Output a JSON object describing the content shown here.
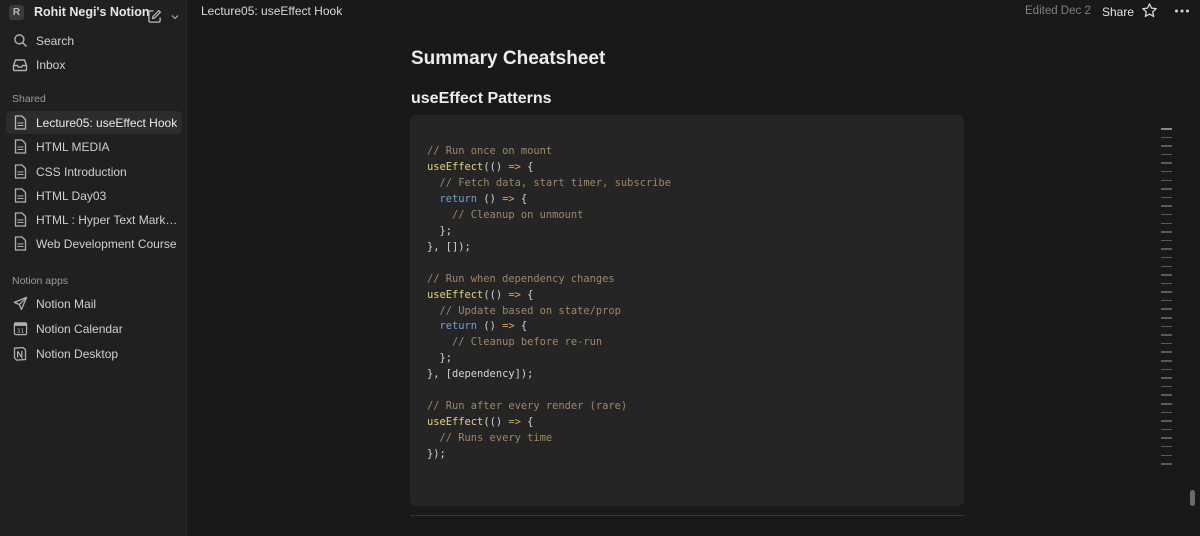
{
  "sidebar": {
    "workspace_initial": "R",
    "workspace_name": "Rohit Negi's Notion",
    "top_items": [
      {
        "label": "Search",
        "icon": "search-icon"
      },
      {
        "label": "Inbox",
        "icon": "inbox-icon"
      }
    ],
    "shared_label": "Shared",
    "shared_items": [
      {
        "label": "Lecture05: useEffect Hook",
        "active": true
      },
      {
        "label": "HTML MEDIA"
      },
      {
        "label": "CSS Introduction"
      },
      {
        "label": "HTML Day03"
      },
      {
        "label": "HTML : Hyper Text Marku..."
      },
      {
        "label": "Web Development Course"
      }
    ],
    "apps_label": "Notion apps",
    "apps_items": [
      {
        "label": "Notion Mail",
        "icon": "mail-send-icon"
      },
      {
        "label": "Notion Calendar",
        "icon": "calendar-icon"
      },
      {
        "label": "Notion Desktop",
        "icon": "notion-logo-icon"
      }
    ]
  },
  "topbar": {
    "breadcrumb": "Lecture05: useEffect Hook",
    "edited": "Edited Dec 2",
    "share_label": "Share"
  },
  "page": {
    "heading1": "Summary Cheatsheet",
    "heading2": "useEffect Patterns",
    "code_lines": [
      "// Run once on mount",
      "useEffect(() => {",
      "  // Fetch data, start timer, subscribe",
      "  return () => {",
      "    // Cleanup on unmount",
      "  };",
      "}, []);",
      "",
      "// Run when dependency changes",
      "useEffect(() => {",
      "  // Update based on state/prop",
      "  return () => {",
      "    // Cleanup before re-run",
      "  };",
      "}, [dependency]);",
      "",
      "// Run after every render (rare)",
      "useEffect(() => {",
      "  // Runs every time",
      "});"
    ]
  },
  "colors": {
    "background": "#191919",
    "sidebar": "#202020",
    "code_bg": "#252525",
    "comment": "#9c8866",
    "function": "#e4d27f",
    "keyword": "#6da2d8",
    "operator": "#d9a35c"
  },
  "toc_count": 40
}
